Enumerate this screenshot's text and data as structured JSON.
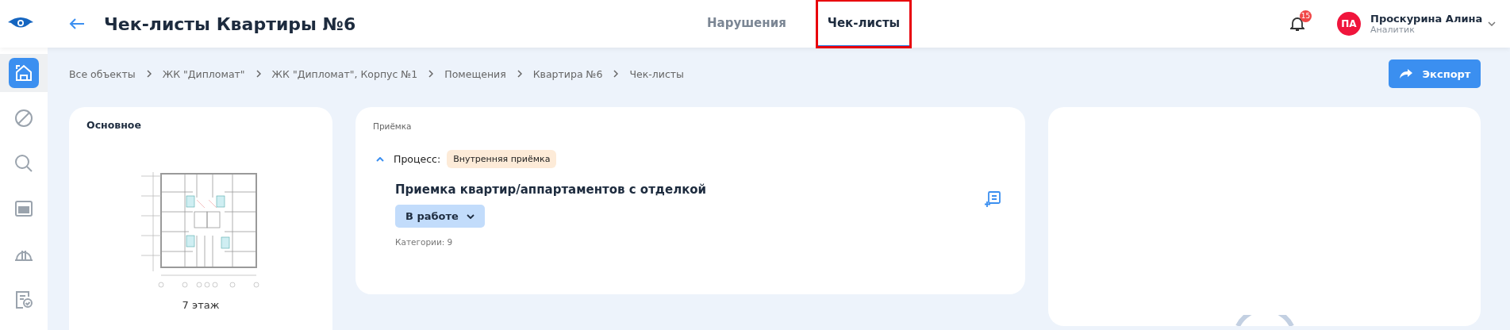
{
  "header": {
    "title": "Чек-листы Квартиры №6",
    "tabs": [
      {
        "label": "Нарушения",
        "selected": false,
        "highlighted": false
      },
      {
        "label": "Чек-листы",
        "selected": true,
        "highlighted": true
      }
    ],
    "notifications": {
      "count": "15"
    },
    "user": {
      "initials": "ПА",
      "name": "Проскурина Алина",
      "role": "Аналитик"
    }
  },
  "sidebar": {
    "items": [
      {
        "selected": true
      },
      {
        "selected": false
      },
      {
        "selected": false
      },
      {
        "selected": false
      },
      {
        "selected": false
      },
      {
        "selected": false
      }
    ]
  },
  "breadcrumbs": [
    "Все объекты",
    "ЖК \"Дипломат\"",
    "ЖК \"Дипломат\", Корпус №1",
    "Помещения",
    "Квартира №6",
    "Чек-листы"
  ],
  "export_button": {
    "label": "Экспорт"
  },
  "main_card": {
    "title": "Основное",
    "floor_label": "7 этаж"
  },
  "checklist_card": {
    "section": "Приёмка",
    "process": {
      "label": "Процесс:",
      "tag": "Внутренняя приёмка",
      "expanded": true
    },
    "title": "Приемка квартир/аппартаментов с отделкой",
    "status": "В работе",
    "categories": "Категории: 9"
  }
}
